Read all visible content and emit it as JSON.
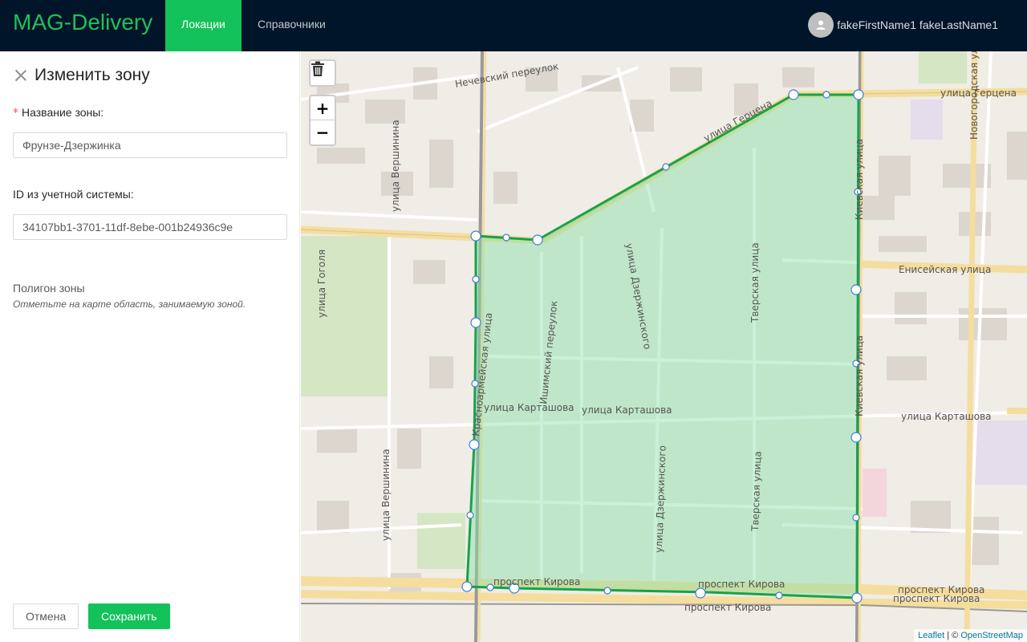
{
  "header": {
    "logo": "MAG-Delivery",
    "nav": [
      {
        "label": "Локации",
        "active": true
      },
      {
        "label": "Справочники",
        "active": false
      }
    ],
    "user_name": "fakeFirstName1 fakeLastName1"
  },
  "panel": {
    "title": "Изменить зону",
    "zone_name_label": "Название зоны",
    "zone_name_value": "Фрунзе-Дзержинка",
    "external_id_label": "ID из учетной системы",
    "external_id_value": "34107bb1-3701-11df-8ebe-001b24936c9e",
    "polygon_title": "Полигон зоны",
    "polygon_hint": "Отметьте на карте область, занимаемую зоной.",
    "cancel_label": "Отмена",
    "save_label": "Сохранить"
  },
  "map": {
    "zoom_in": "+",
    "zoom_out": "−",
    "attribution_leaflet": "Leaflet",
    "attribution_sep": " | © ",
    "attribution_osm": "OpenStreetMap",
    "streets": [
      "Нечевский переулок",
      "улица Герцена",
      "улица Герцена",
      "Новогородская улица",
      "улица Вершинина",
      "улица Вершинина",
      "Киевская улица",
      "Енисейская улица",
      "улица Гоголя",
      "улица Дзержинского",
      "Тверская улица",
      "Ишимский переулок",
      "Красноармейская улица",
      "улица Карташова",
      "улица Карташова",
      "улица Карташова",
      "улица Дзержинского",
      "Тверская улица",
      "проспект Кирова",
      "проспект Кирова",
      "проспект Кирова",
      "проспект Кирова",
      "проспект Кирова",
      "Киевская улица"
    ]
  },
  "colors": {
    "header_bg": "#001529",
    "accent": "#13c25a",
    "polygon_stroke": "#16a34a",
    "polygon_fill": "#86e0a8"
  },
  "icons": [
    "close-icon",
    "user-icon",
    "trash-icon"
  ]
}
